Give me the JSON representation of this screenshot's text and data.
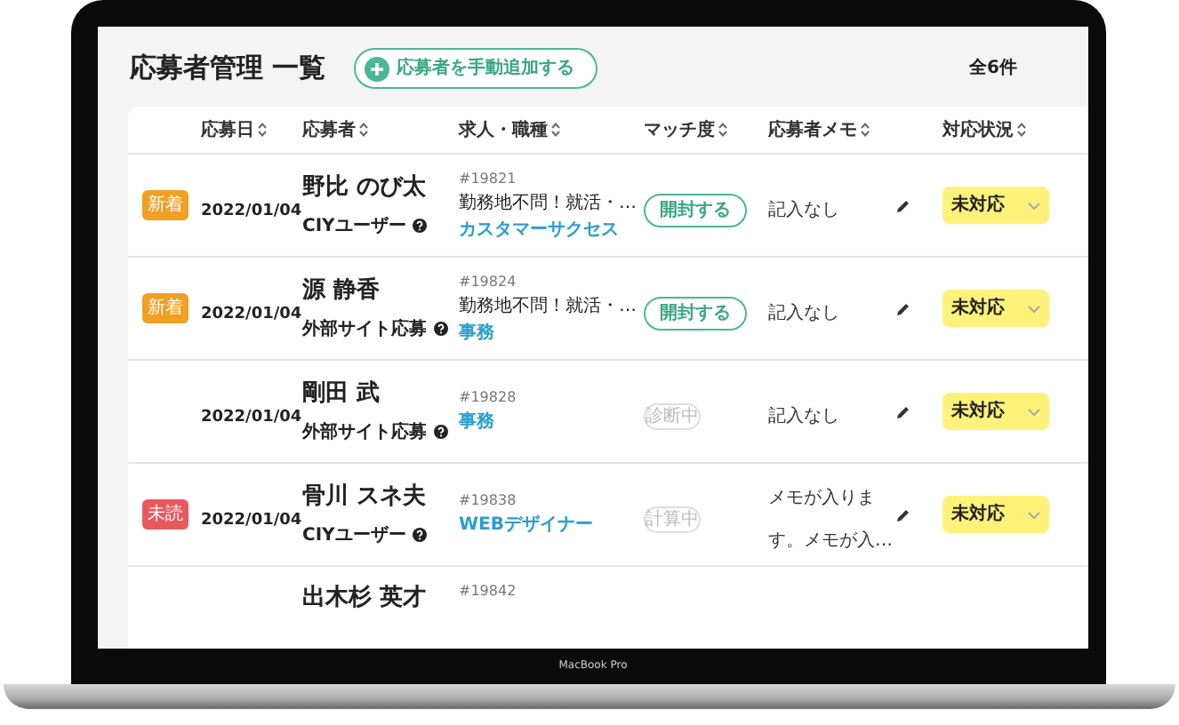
{
  "page": {
    "title": "応募者管理 一覧",
    "add_button": "応募者を手動追加する",
    "total": "全6件"
  },
  "table": {
    "columns": [
      "応募日",
      "応募者",
      "求人・職種",
      "マッチ度",
      "応募者メモ",
      "対応状況"
    ],
    "rows": [
      {
        "badge": {
          "label": "新着",
          "kind": "new"
        },
        "date": "2022/01/04",
        "name": "野比 のび太",
        "source": "CIYユーザー",
        "job_id": "#19821",
        "job_desc": "勤務地不問！就活・…",
        "job_title": "カスタマーサクセス",
        "match": {
          "label": "開封する",
          "kind": "action"
        },
        "memo": "記入なし",
        "status": "未対応"
      },
      {
        "badge": {
          "label": "新着",
          "kind": "new"
        },
        "date": "2022/01/04",
        "name": "源 静香",
        "source": "外部サイト応募",
        "job_id": "#19824",
        "job_desc": "勤務地不問！就活・…",
        "job_title": "事務",
        "match": {
          "label": "開封する",
          "kind": "action"
        },
        "memo": "記入なし",
        "status": "未対応"
      },
      {
        "date": "2022/01/04",
        "name": "剛田 武",
        "source": "外部サイト応募",
        "job_id": "#19828",
        "job_title": "事務",
        "match": {
          "label": "診断中",
          "kind": "pending"
        },
        "memo": "記入なし",
        "status": "未対応"
      },
      {
        "badge": {
          "label": "未読",
          "kind": "unread"
        },
        "date": "2022/01/04",
        "name": "骨川 スネ夫",
        "source": "CIYユーザー",
        "job_id": "#19838",
        "job_title": "WEBデザイナー",
        "match": {
          "label": "計算中",
          "kind": "pending"
        },
        "memo": "メモが入ります。メモが入…",
        "status": "未対応"
      },
      {
        "name": "出木杉 英才",
        "job_id": "#19842"
      }
    ]
  },
  "device": {
    "label": "MacBook Pro"
  }
}
